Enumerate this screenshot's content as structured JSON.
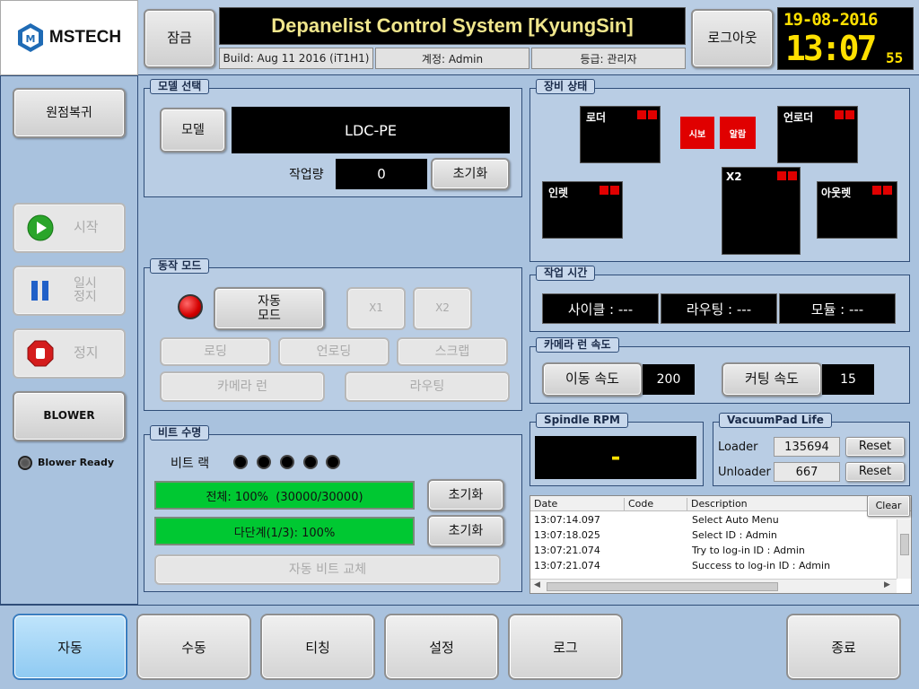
{
  "header": {
    "brand": "MSTECH",
    "lock_label": "잠금",
    "title": "Depanelist Control System [KyungSin]",
    "build": "Build: Aug 11 2016 (iT1H1)",
    "account": "계정: Admin",
    "grade": "등급: 관리자",
    "logout_label": "로그아웃",
    "clock_date": "19-08-2016",
    "clock_time": "13:07",
    "clock_seconds": "55"
  },
  "left": {
    "home_label": "원점복귀",
    "start_label": "시작",
    "pause_label": "일시\n정지",
    "stop_label": "정지",
    "blower_label": "BLOWER",
    "blower_ready": "Blower Ready"
  },
  "model": {
    "title": "모델 선택",
    "model_button": "모델",
    "model_value": "LDC-PE",
    "work_label": "작업량",
    "work_value": "0",
    "reset_label": "초기화"
  },
  "mode": {
    "title": "동작 모드",
    "auto_mode": "자동\n모드",
    "x1": "X1",
    "x2": "X2",
    "loading": "로딩",
    "unloading": "언로딩",
    "scrap": "스크랩",
    "camera_run": "카메라 런",
    "routing": "라우팅"
  },
  "bit": {
    "title": "비트 수명",
    "rack_label": "비트 랙",
    "total": "전체: 100%  (30000/30000)",
    "stage": "다단계(1/3): 100%",
    "reset1": "초기화",
    "reset2": "초기화",
    "auto_change": "자동 비트 교체"
  },
  "equipment": {
    "title": "장비 상태",
    "loader": "로더",
    "unloader": "언로더",
    "inlet": "인렛",
    "x2": "X2",
    "outlet": "아웃렛",
    "signal": "시보",
    "alarm": "알람"
  },
  "worktime": {
    "title": "작업 시간",
    "cycle": "사이클 : ---",
    "routing": "라우팅 : ---",
    "module": "모듈 : ---"
  },
  "camera_speed": {
    "title": "카메라 런 속도",
    "move_label": "이동 속도",
    "move_value": "200",
    "cut_label": "커팅 속도",
    "cut_value": "15"
  },
  "spindle": {
    "title": "Spindle RPM",
    "value": "-"
  },
  "vacuum": {
    "title": "VacuumPad Life",
    "loader_label": "Loader",
    "loader_value": "135694",
    "unloader_label": "Unloader",
    "unloader_value": "667",
    "reset_label": "Reset"
  },
  "log": {
    "col_date": "Date",
    "col_code": "Code",
    "col_desc": "Description",
    "clear_label": "Clear",
    "rows": [
      {
        "date": "13:07:14.097",
        "code": "",
        "desc": "Select Auto Menu"
      },
      {
        "date": "13:07:18.025",
        "code": "",
        "desc": "Select ID : Admin"
      },
      {
        "date": "13:07:21.074",
        "code": "",
        "desc": "Try to log-in ID : Admin"
      },
      {
        "date": "13:07:21.074",
        "code": "",
        "desc": "Success to log-in ID : Admin"
      }
    ]
  },
  "nav": {
    "auto": "자동",
    "manual": "수동",
    "teaching": "티칭",
    "settings": "설정",
    "log": "로그",
    "exit": "종료"
  },
  "colors": {
    "panel_border": "#2f4d78",
    "header_text": "#f0e68c",
    "clock": "#ffe000",
    "indicator": "#e00000",
    "progress": "#00c832",
    "nav_active": "#9fd3f7"
  }
}
